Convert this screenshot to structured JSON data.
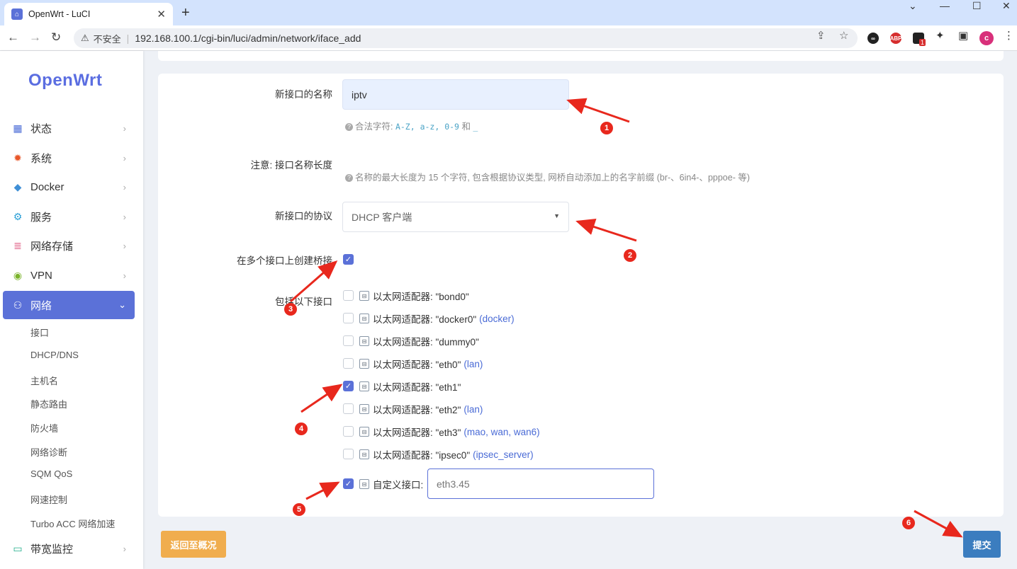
{
  "browser": {
    "tab_title": "OpenWrt - LuCI",
    "security_label": "不安全",
    "url": "192.168.100.1/cgi-bin/luci/admin/network/iface_add",
    "profile_initial": "c",
    "ext_badge": "1",
    "abp_label": "ABP"
  },
  "sidebar": {
    "logo": "OpenWrt",
    "items": [
      {
        "label": "状态",
        "icon": "dashboard-icon"
      },
      {
        "label": "系统",
        "icon": "gear-icon"
      },
      {
        "label": "Docker",
        "icon": "docker-icon"
      },
      {
        "label": "服务",
        "icon": "services-icon"
      },
      {
        "label": "网络存储",
        "icon": "storage-icon"
      },
      {
        "label": "VPN",
        "icon": "vpn-icon"
      },
      {
        "label": "网络",
        "icon": "network-icon",
        "active": true
      }
    ],
    "sub_items": [
      "接口",
      "DHCP/DNS",
      "主机名",
      "静态路由",
      "防火墙",
      "网络诊断",
      "SQM QoS",
      "网速控制",
      "Turbo ACC 网络加速"
    ],
    "bottom_item": {
      "label": "带宽监控",
      "icon": "monitor-icon"
    }
  },
  "form": {
    "name_label": "新接口的名称",
    "name_value": "iptv",
    "name_help_prefix": "合法字符: ",
    "name_help_code1": "A-Z, a-z, 0-9",
    "name_help_and": " 和 ",
    "name_help_code2": "_",
    "note_label": "注意: 接口名称长度",
    "note_help": "名称的最大长度为 15 个字符, 包含根据协议类型, 网桥自动添加上的名字前缀 (br-、6in4-、pppoe- 等)",
    "proto_label": "新接口的协议",
    "proto_value": "DHCP 客户端",
    "bridge_label": "在多个接口上创建桥接",
    "include_label": "包括以下接口",
    "interfaces": [
      {
        "text": "以太网适配器: \"bond0\"",
        "zone": "",
        "checked": false
      },
      {
        "text": "以太网适配器: \"docker0\"",
        "zone": "(docker)",
        "checked": false
      },
      {
        "text": "以太网适配器: \"dummy0\"",
        "zone": "",
        "checked": false
      },
      {
        "text": "以太网适配器: \"eth0\"",
        "zone": "(lan)",
        "checked": false
      },
      {
        "text": "以太网适配器: \"eth1\"",
        "zone": "",
        "checked": true
      },
      {
        "text": "以太网适配器: \"eth2\"",
        "zone": "(lan)",
        "checked": false
      },
      {
        "text": "以太网适配器: \"eth3\"",
        "zone": "(mao, wan, wan6)",
        "checked": false
      },
      {
        "text": "以太网适配器: \"ipsec0\"",
        "zone": "(ipsec_server)",
        "checked": false
      }
    ],
    "custom_label": "自定义接口:",
    "custom_value": "eth3.45"
  },
  "buttons": {
    "back": "返回至概况",
    "submit": "提交"
  },
  "annotations": [
    "1",
    "2",
    "3",
    "4",
    "5",
    "6"
  ],
  "colors": {
    "accent": "#5b71d8",
    "back_button": "#f0ad4e",
    "submit_button": "#3b7dbf",
    "annotation": "#e8281d"
  }
}
